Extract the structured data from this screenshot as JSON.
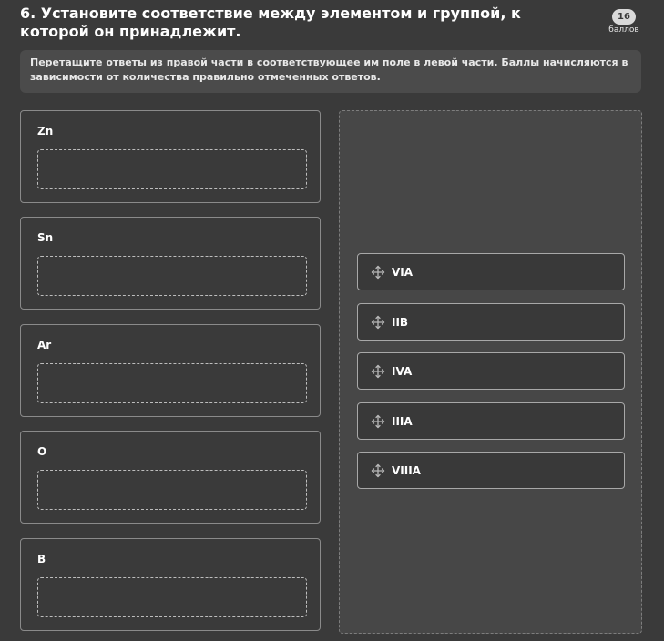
{
  "question": {
    "title": "6. Установите соответствие между элементом и группой, к которой он принадлежит.",
    "points_value": "16",
    "points_label": "баллов",
    "instructions": "Перетащите ответы из правой части в соответствующее им поле в левой части. Баллы начисляются в зависимости от количества правильно отмеченных ответов."
  },
  "elements": [
    {
      "label": "Zn"
    },
    {
      "label": "Sn"
    },
    {
      "label": "Ar"
    },
    {
      "label": "O"
    },
    {
      "label": "B"
    }
  ],
  "options": [
    {
      "label": "VIA",
      "icon": "move-icon"
    },
    {
      "label": "IIB",
      "icon": "move-icon"
    },
    {
      "label": "IVA",
      "icon": "move-icon"
    },
    {
      "label": "IIIA",
      "icon": "move-icon"
    },
    {
      "label": "VIIIA",
      "icon": "move-icon"
    }
  ]
}
